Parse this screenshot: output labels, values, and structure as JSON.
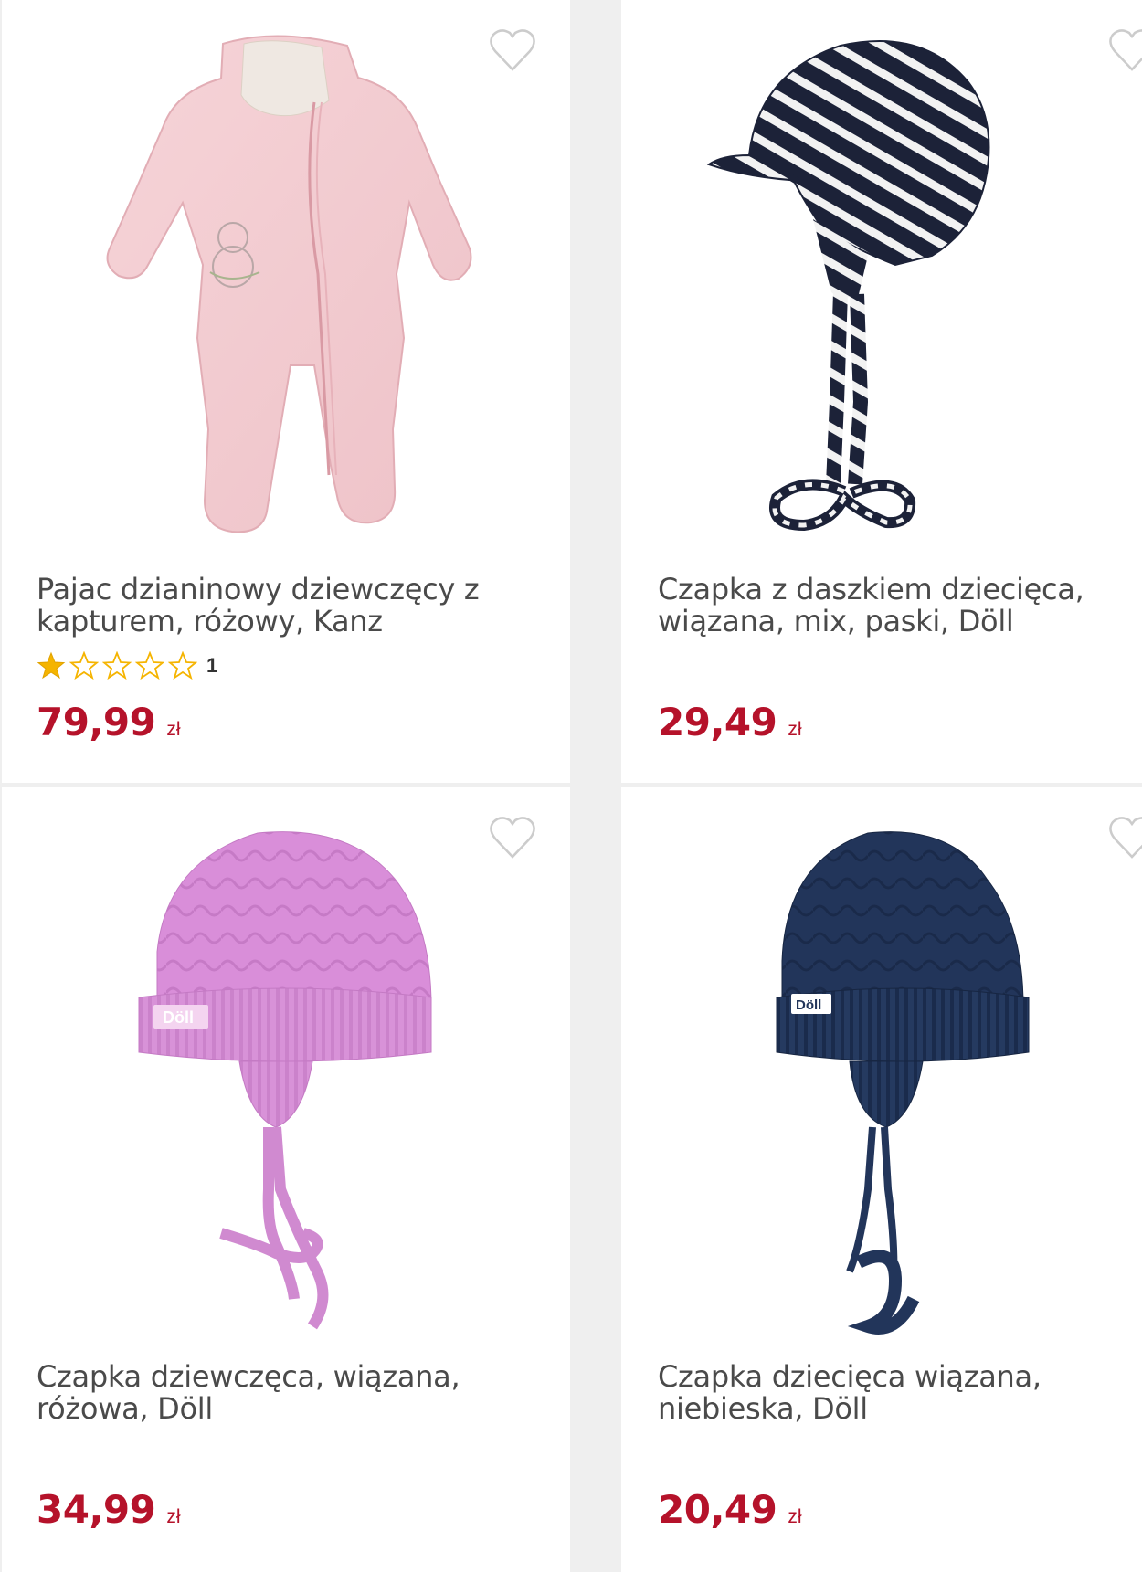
{
  "products": [
    {
      "name": "Pajac dzianinowy dziewczęcy z kapturem, różowy, Kanz",
      "rating": {
        "filled_stars": 1,
        "total_stars": 5,
        "count": "1"
      },
      "price": "79,99",
      "currency": "zł",
      "image_icon": "pink-snowsuit"
    },
    {
      "name": "Czapka z daszkiem dziecięca, wiązana, mix, paski, Döll",
      "price": "29,49",
      "currency": "zł",
      "image_icon": "striped-cap"
    },
    {
      "name": "Czapka dziewczęca, wiązana, różowa, Döll",
      "price": "34,99",
      "currency": "zł",
      "image_icon": "pink-knit-hat"
    },
    {
      "name": "Czapka dziecięca wiązana, niebieska, Döll",
      "price": "20,49",
      "currency": "zł",
      "image_icon": "navy-knit-hat"
    }
  ],
  "brand_tag": "Döll",
  "colors": {
    "price": "#b5122a",
    "star": "#f5b400",
    "heart": "#cccccc"
  }
}
